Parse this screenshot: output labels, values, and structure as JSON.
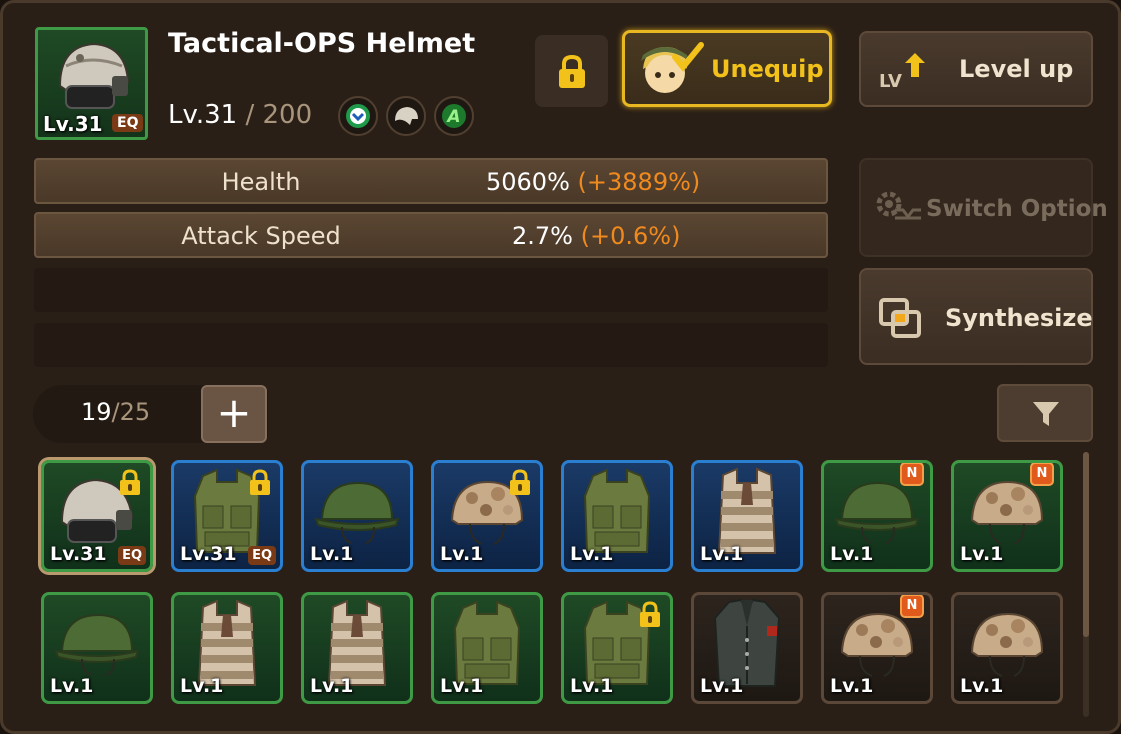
{
  "item": {
    "name": "Tactical-OPS Helmet",
    "level_badge": "Lv.31",
    "eq_tag": "EQ",
    "level": "Lv.31",
    "level_sep": " / ",
    "max_level": "200",
    "badges": [
      "shield-rank-icon",
      "helmet-type-icon",
      "grade-a-icon"
    ],
    "grade_letter": "A"
  },
  "buttons": {
    "unequip": "Unequip",
    "level_up": "Level up",
    "level_up_icon_text": "LV",
    "switch_option": "Switch Option",
    "synthesize": "Synthesize"
  },
  "stats": [
    {
      "label": "Health",
      "value": "5060%",
      "bonus": "(+3889%)"
    },
    {
      "label": "Attack Speed",
      "value": "2.7%",
      "bonus": "(+0.6%)"
    }
  ],
  "inventory": {
    "count": "19",
    "sep": "/",
    "capacity": "25",
    "plus": "+",
    "slots": [
      {
        "lv": "Lv.31",
        "eq": "EQ",
        "rarity": "green",
        "type": "tactical-helmet",
        "locked": true,
        "new": false,
        "selected": true
      },
      {
        "lv": "Lv.31",
        "eq": "EQ",
        "rarity": "blue",
        "type": "green-vest",
        "locked": true,
        "new": false
      },
      {
        "lv": "Lv.1",
        "eq": "",
        "rarity": "blue",
        "type": "green-helmet",
        "locked": false,
        "new": false
      },
      {
        "lv": "Lv.1",
        "eq": "",
        "rarity": "blue",
        "type": "camo-helmet",
        "locked": true,
        "new": false
      },
      {
        "lv": "Lv.1",
        "eq": "",
        "rarity": "blue",
        "type": "green-vest",
        "locked": false,
        "new": false
      },
      {
        "lv": "Lv.1",
        "eq": "",
        "rarity": "blue",
        "type": "camo-vest",
        "locked": false,
        "new": false
      },
      {
        "lv": "Lv.1",
        "eq": "",
        "rarity": "green",
        "type": "green-helmet",
        "locked": false,
        "new": true
      },
      {
        "lv": "Lv.1",
        "eq": "",
        "rarity": "green",
        "type": "camo-helmet",
        "locked": false,
        "new": true
      },
      {
        "lv": "Lv.1",
        "eq": "",
        "rarity": "green",
        "type": "green-helmet",
        "locked": false,
        "new": false
      },
      {
        "lv": "Lv.1",
        "eq": "",
        "rarity": "green",
        "type": "camo-vest",
        "locked": false,
        "new": false
      },
      {
        "lv": "Lv.1",
        "eq": "",
        "rarity": "green",
        "type": "camo-vest",
        "locked": false,
        "new": false
      },
      {
        "lv": "Lv.1",
        "eq": "",
        "rarity": "green",
        "type": "green-vest",
        "locked": false,
        "new": false
      },
      {
        "lv": "Lv.1",
        "eq": "",
        "rarity": "green",
        "type": "green-vest",
        "locked": true,
        "new": false
      },
      {
        "lv": "Lv.1",
        "eq": "",
        "rarity": "brown",
        "type": "officer-coat",
        "locked": false,
        "new": false
      },
      {
        "lv": "Lv.1",
        "eq": "",
        "rarity": "brown",
        "type": "camo-helmet",
        "locked": false,
        "new": true
      },
      {
        "lv": "Lv.1",
        "eq": "",
        "rarity": "brown",
        "type": "camo-helmet",
        "locked": false,
        "new": false
      }
    ],
    "new_label": "N"
  },
  "colors": {
    "accent_gold": "#e8b822",
    "bonus_orange": "#f08a1e",
    "rarity_green": "#3f9a45",
    "rarity_blue": "#2b7fd1"
  }
}
